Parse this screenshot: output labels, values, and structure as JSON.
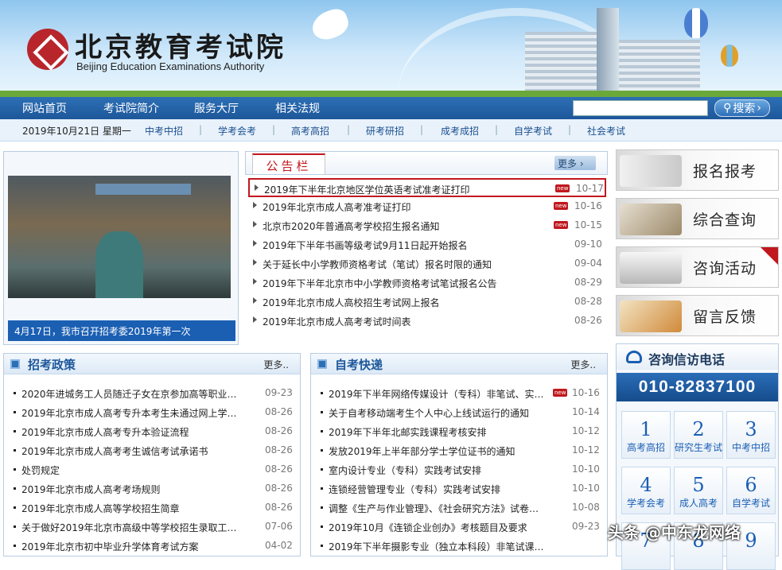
{
  "header": {
    "cn_title": "北京教育考试院",
    "en_title": "Beijing Education Examinations Authority"
  },
  "nav": {
    "items": [
      "网站首页",
      "考试院简介",
      "服务大厅",
      "相关法规"
    ],
    "search_placeholder": "",
    "search_label": "搜索"
  },
  "subnav": {
    "date": "2019年10月21日  星期一",
    "items": [
      "中考中招",
      "学考会考",
      "高考高招",
      "研考研招",
      "成考成招",
      "自学考试",
      "社会考试"
    ]
  },
  "photo": {
    "caption": "4月17日，我市召开招考委2019年第一次"
  },
  "notice": {
    "tab": "公告栏",
    "more": "更多",
    "rows": [
      {
        "title": "2019年下半年北京地区学位英语考试准考证打印",
        "date": "10-17",
        "new": "new"
      },
      {
        "title": "2019年北京市成人高考准考证打印",
        "date": "10-16",
        "new": "new"
      },
      {
        "title": "北京市2020年普通高考学校招生报名通知",
        "date": "10-15",
        "new": "new"
      },
      {
        "title": "2019年下半年书画等级考试9月11日起开始报名",
        "date": "09-10",
        "new": ""
      },
      {
        "title": "关于延长中小学教师资格考试（笔试）报名时限的通知",
        "date": "09-04",
        "new": ""
      },
      {
        "title": "2019年下半年北京市中小学教师资格考试笔试报名公告",
        "date": "08-29",
        "new": ""
      },
      {
        "title": "2019年北京市成人高校招生考试网上报名",
        "date": "08-28",
        "new": ""
      },
      {
        "title": "2019年北京市成人高考考试时间表",
        "date": "08-26",
        "new": ""
      }
    ]
  },
  "side_buttons": [
    "报名报考",
    "综合查询",
    "咨询活动",
    "留言反馈"
  ],
  "zhaokao": {
    "title": "招考政策",
    "more": "更多..",
    "rows": [
      {
        "title": "2020年进城务工人员随迁子女在京参加高等职业学…",
        "date": "09-23"
      },
      {
        "title": "2019年北京市成人高考专升本考生未通过网上学历…",
        "date": "08-26"
      },
      {
        "title": "2019年北京市成人高考专升本验证流程",
        "date": "08-26"
      },
      {
        "title": "2019年北京市成人高考考生诚信考试承诺书",
        "date": "08-26"
      },
      {
        "title": "处罚规定",
        "date": "08-26"
      },
      {
        "title": "2019年北京市成人高考考场规则",
        "date": "08-26"
      },
      {
        "title": "2019年北京市成人高等学校招生简章",
        "date": "08-26"
      },
      {
        "title": "关于做好2019年北京市高级中等学校招生录取工作…",
        "date": "07-06"
      },
      {
        "title": "2019年北京市初中毕业升学体育考试方案",
        "date": "04-02"
      }
    ]
  },
  "zikao": {
    "title": "自考快递",
    "more": "更多..",
    "rows": [
      {
        "title": "2019年下半年网络传媒设计（专科）非笔试、实践…",
        "date": "10-16",
        "new": "new"
      },
      {
        "title": "关于自考移动端考生个人中心上线试运行的通知",
        "date": "10-14",
        "new": ""
      },
      {
        "title": "2019年下半年北邮实践课程考核安排",
        "date": "10-12",
        "new": ""
      },
      {
        "title": "发放2019年上半年部分学士学位证书的通知",
        "date": "10-12",
        "new": ""
      },
      {
        "title": "室内设计专业（专科）实践考试安排",
        "date": "10-10",
        "new": ""
      },
      {
        "title": "连锁经营管理专业（专科）实践考试安排",
        "date": "10-10",
        "new": ""
      },
      {
        "title": "调整《生产与作业管理》、《社会研究方法》试卷…",
        "date": "10-08",
        "new": ""
      },
      {
        "title": "2019年10月《连锁企业创办》考核题目及要求",
        "date": "09-23",
        "new": ""
      },
      {
        "title": "2019年下半年摄影专业（独立本科段）非笔试课程…",
        "date": "",
        "new": ""
      }
    ]
  },
  "phone": {
    "title": "咨询信访电话",
    "number": "010-82837100",
    "cells": [
      {
        "num": "1",
        "label": "高考高招"
      },
      {
        "num": "2",
        "label": "研究生考试"
      },
      {
        "num": "3",
        "label": "中考中招"
      },
      {
        "num": "4",
        "label": "学考会考"
      },
      {
        "num": "5",
        "label": "成人高考"
      },
      {
        "num": "6",
        "label": "自学考试"
      },
      {
        "num": "7",
        "label": ""
      },
      {
        "num": "8",
        "label": ""
      },
      {
        "num": "9",
        "label": ""
      }
    ]
  },
  "watermark": "头条 @中东龙网络",
  "icons": [
    "logo-mark",
    "search-icon",
    "chevron-right-icon",
    "phone-icon",
    "bullet-icon"
  ],
  "colors": {
    "nav_blue": "#1d579a",
    "accent_red": "#c0181e",
    "link_blue": "#1a4f8f"
  }
}
